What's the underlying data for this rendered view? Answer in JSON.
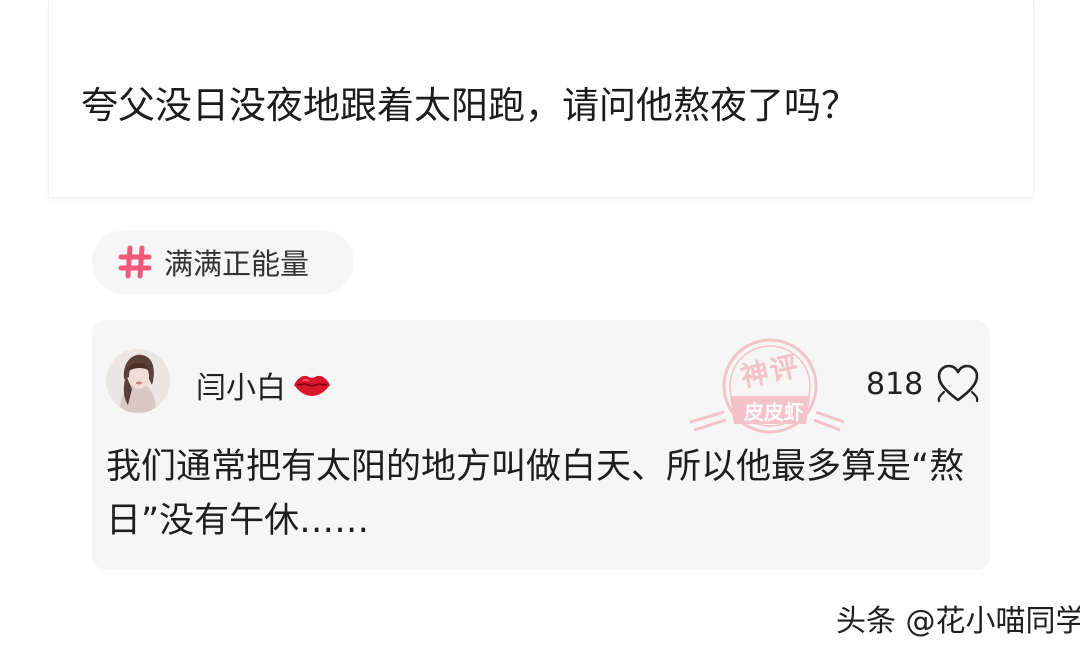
{
  "question": {
    "text": "夸父没日没夜地跟着太阳跑，请问他熬夜了吗？"
  },
  "tag": {
    "icon": "hash-icon",
    "label": "满满正能量",
    "icon_color": "#f0597a"
  },
  "comment": {
    "username": "闫小白",
    "username_badge": "lips-icon",
    "like_count": "818",
    "like_icon": "heart-outline-icon",
    "text": "我们通常把有太阳的地方叫做白天、所以他最多算是“熬日”没有午休……",
    "stamp": {
      "line1": "神评",
      "line2": "皮皮虾",
      "color": "#f19aa6"
    }
  },
  "watermark": {
    "text": "头条 @花小喵同学"
  }
}
